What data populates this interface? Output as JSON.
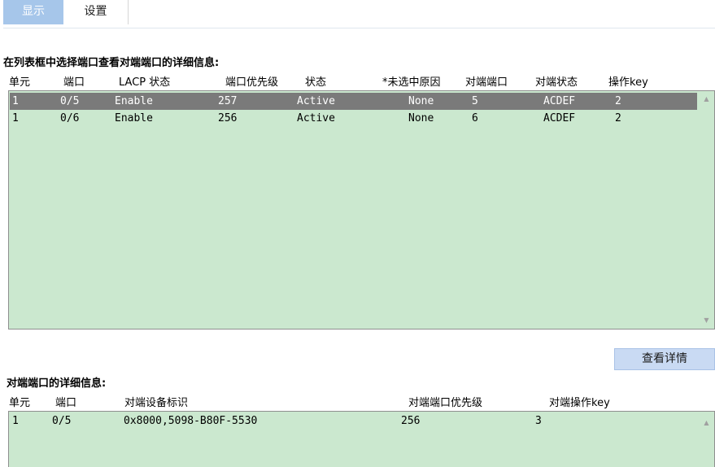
{
  "tabs": [
    {
      "label": "显示",
      "active": true
    },
    {
      "label": "设置",
      "active": false
    }
  ],
  "colors": {
    "active_tab": "#a6c6ea",
    "list_background": "#cbe8cf",
    "selected_row": "#7a7a7a",
    "button_background": "#c9daf3"
  },
  "top_section": {
    "title": "在列表框中选择端口查看对端端口的详细信息:",
    "columns": [
      "单元",
      "端口",
      "LACP 状态",
      "端口优先级",
      "状态",
      "*未选中原因",
      "对端端口",
      "对端状态",
      "操作key"
    ],
    "rows": [
      {
        "unit": "1",
        "port": "0/5",
        "lacp": "Enable",
        "priority": "257",
        "status": "Active",
        "reason": "None",
        "peer_port": "5",
        "peer_state": "ACDEF",
        "key": "2",
        "selected": true
      },
      {
        "unit": "1",
        "port": "0/6",
        "lacp": "Enable",
        "priority": "256",
        "status": "Active",
        "reason": "None",
        "peer_port": "6",
        "peer_state": "ACDEF",
        "key": "2",
        "selected": false
      }
    ]
  },
  "details_button": {
    "label": "查看详情"
  },
  "bottom_section": {
    "title": "对端端口的详细信息:",
    "columns": [
      "单元",
      "端口",
      "对端设备标识",
      "对端端口优先级",
      "对端操作key"
    ],
    "rows": [
      {
        "unit": "1",
        "port": "0/5",
        "device_id": "0x8000,5098-B80F-5530",
        "priority": "256",
        "key": "3"
      }
    ]
  },
  "scroll_icons": {
    "up": "scroll-up-arrow-icon",
    "down": "scroll-down-arrow-icon"
  }
}
